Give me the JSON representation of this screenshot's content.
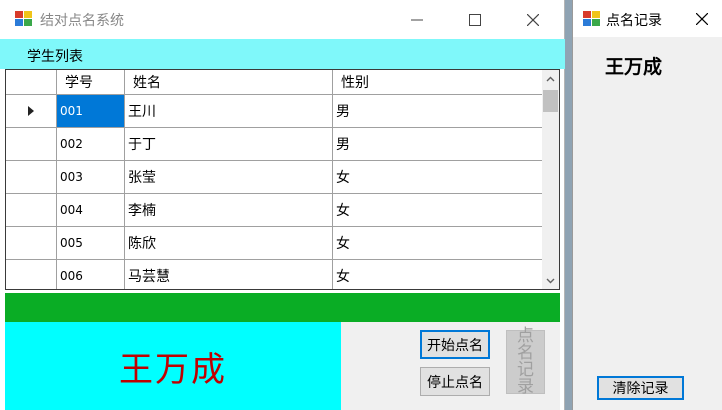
{
  "main_window": {
    "title": "结对点名系统",
    "menu": {
      "student_list": "学生列表"
    },
    "grid": {
      "columns": [
        "学号",
        "姓名",
        "性别"
      ],
      "rows": [
        {
          "id": "001",
          "name": "王川",
          "sex": "男",
          "selected": true
        },
        {
          "id": "002",
          "name": "于丁",
          "sex": "男",
          "selected": false
        },
        {
          "id": "003",
          "name": "张莹",
          "sex": "女",
          "selected": false
        },
        {
          "id": "004",
          "name": "李楠",
          "sex": "女",
          "selected": false
        },
        {
          "id": "005",
          "name": "陈欣",
          "sex": "女",
          "selected": false
        },
        {
          "id": "006",
          "name": "马芸慧",
          "sex": "女",
          "selected": false
        }
      ]
    },
    "display_name": "王万成",
    "buttons": {
      "start": "开始点名",
      "stop": "停止点名",
      "record": "点名记录"
    }
  },
  "record_window": {
    "title": "点名记录",
    "entries": [
      "王万成"
    ],
    "clear_button": "清除记录"
  },
  "colors": {
    "menubar": "#7ff8fa",
    "selection": "#0078d7",
    "green_bar": "#0aad25",
    "name_panel": "#00ffff",
    "name_text": "#c00000"
  },
  "icons": [
    "app-icon",
    "minimize-icon",
    "maximize-icon",
    "close-icon",
    "row-pointer-icon",
    "scroll-up-icon",
    "scroll-down-icon"
  ]
}
